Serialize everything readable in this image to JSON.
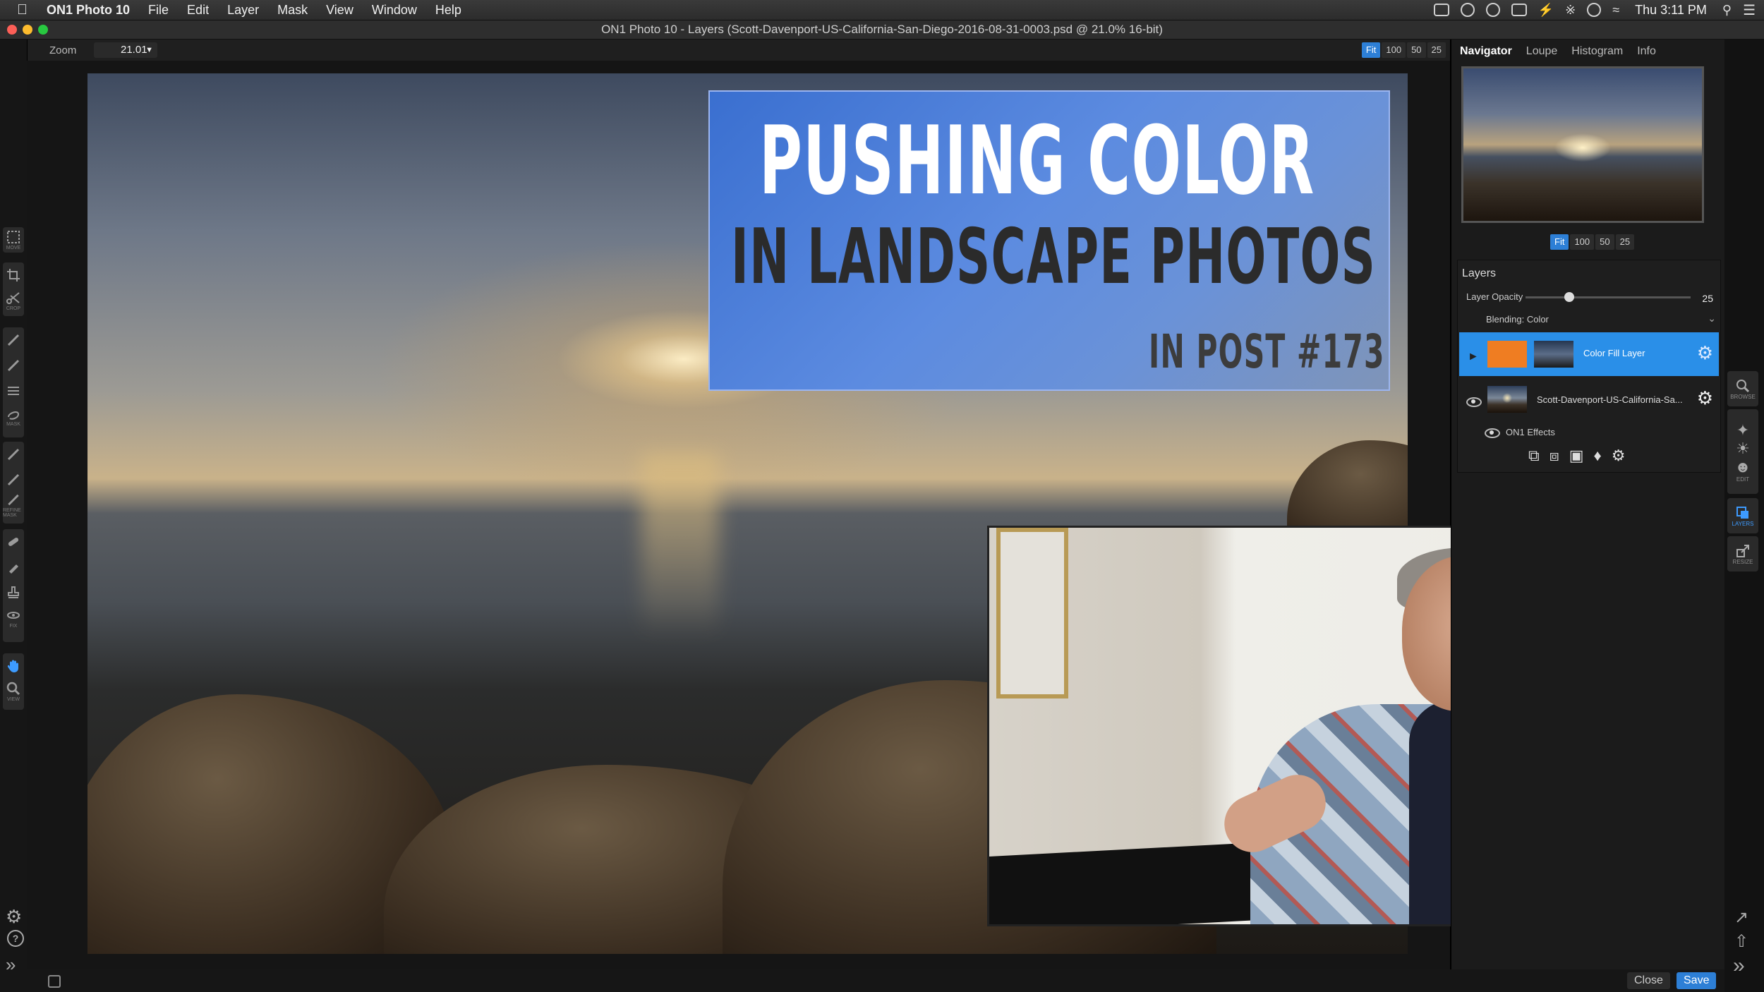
{
  "menubar": {
    "app_name": "ON1 Photo 10",
    "menus": [
      "File",
      "Edit",
      "Layer",
      "Mask",
      "View",
      "Window",
      "Help"
    ],
    "clock": "Thu 3:11 PM"
  },
  "window": {
    "title": "ON1 Photo 10 - Layers (Scott-Davenport-US-California-San-Diego-2016-08-31-0003.psd @ 21.0% 16-bit)"
  },
  "toolbar": {
    "zoom_label": "Zoom",
    "zoom_value": "21.01",
    "zoom_buttons": [
      "Fit",
      "100",
      "50",
      "25"
    ]
  },
  "left_tools": {
    "move_cap": "MOVE",
    "crop_cap": "CROP",
    "mask_cap": "MASK",
    "refine_cap": "REFINE MASK",
    "fix_cap": "FIX",
    "view_cap": "VIEW"
  },
  "overlay": {
    "line1": "PUSHING COLOR",
    "line2": "IN LANDSCAPE PHOTOS",
    "line3": "IN POST #173"
  },
  "panel": {
    "tabs": [
      "Navigator",
      "Loupe",
      "Histogram",
      "Info"
    ],
    "nav_zoom_buttons": [
      "Fit",
      "100",
      "50",
      "25"
    ],
    "layers_title": "Layers",
    "opacity_label": "Layer Opacity",
    "opacity_value": "25",
    "opacity_fraction": 0.25,
    "blending_label": "Blending: Color",
    "layers": [
      {
        "name": "Color Fill Layer",
        "fill": "#ef7d22",
        "selected": true
      },
      {
        "name": "Scott-Davenport-US-California-Sa...",
        "selected": false
      }
    ],
    "effects_label": "ON1 Effects"
  },
  "modules": {
    "browse": "BROWSE",
    "edit": "EDIT",
    "layers": "LAYERS",
    "resize": "RESIZE"
  },
  "bottom": {
    "close_label": "Close",
    "save_label": "Save"
  },
  "colors": {
    "accent": "#2d7fd6",
    "selected_layer": "#2a8fe8",
    "title_overlay": "#4f7fdc"
  }
}
